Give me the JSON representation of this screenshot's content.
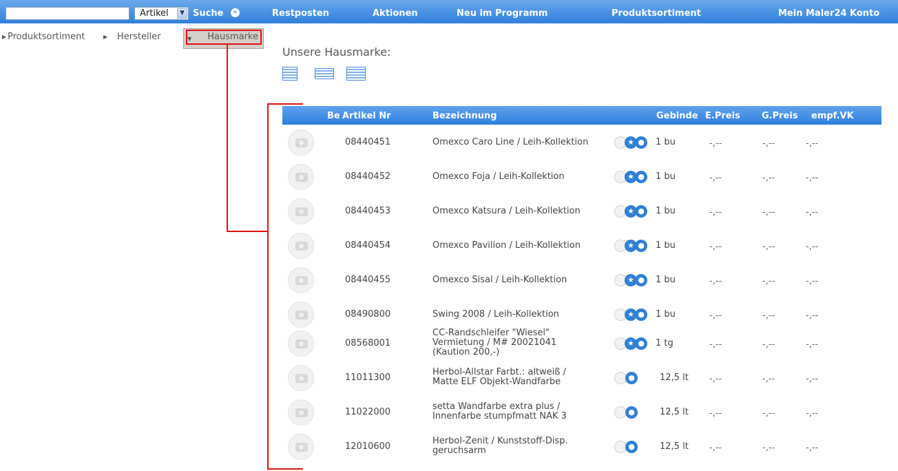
{
  "search": {
    "value": "",
    "scope": "Artikel",
    "submit_label": "Suche"
  },
  "nav": [
    "Restposten",
    "Aktionen",
    "Neu im Programm",
    "Produktsortiment",
    "Mein Maler24 Konto"
  ],
  "breadcrumb": [
    "Produktsortiment",
    "Hersteller",
    "Hausmarke"
  ],
  "page_title": "Unsere Hausmarke:",
  "table": {
    "headers": [
      "Be",
      "Artikel Nr",
      "Bezeichnung",
      "Gebinde",
      "E.Preis",
      "G.Preis",
      "empf.VK"
    ],
    "rows": [
      {
        "art": "08440451",
        "desc": [
          "Omexco Caro Line / Leih-Kollektion"
        ],
        "icons": [
          "gray",
          "star",
          "drop"
        ],
        "gebinde": "1 bu",
        "ep": "-,--",
        "gp": "-,--",
        "vk": "-,--"
      },
      {
        "art": "08440452",
        "desc": [
          "Omexco Foja / Leih-Kollektion"
        ],
        "icons": [
          "gray",
          "star",
          "drop"
        ],
        "gebinde": "1 bu",
        "ep": "-,--",
        "gp": "-,--",
        "vk": "-,--"
      },
      {
        "art": "08440453",
        "desc": [
          "Omexco Katsura / Leih-Kollektion"
        ],
        "icons": [
          "gray",
          "star",
          "drop"
        ],
        "gebinde": "1 bu",
        "ep": "-,--",
        "gp": "-,--",
        "vk": "-,--"
      },
      {
        "art": "08440454",
        "desc": [
          "Omexco Pavilion / Leih-Kollektion"
        ],
        "icons": [
          "gray",
          "star",
          "drop"
        ],
        "gebinde": "1 bu",
        "ep": "-,--",
        "gp": "-,--",
        "vk": "-,--"
      },
      {
        "art": "08440455",
        "desc": [
          "Omexco Sisal / Leih-Kollektion"
        ],
        "icons": [
          "gray",
          "star",
          "drop"
        ],
        "gebinde": "1 bu",
        "ep": "-,--",
        "gp": "-,--",
        "vk": "-,--"
      },
      {
        "art": "08490800",
        "desc": [
          "Swing 2008 / Leih-Kollektion"
        ],
        "icons": [
          "gray",
          "star",
          "drop"
        ],
        "gebinde": "1 bu",
        "ep": "-,--",
        "gp": "-,--",
        "vk": "-,--"
      },
      {
        "art": "08568001",
        "desc": [
          "CC-Randschleifer \"Wiesel\"",
          "Vermietung / M# 20021041",
          "(Kaution 200,-)"
        ],
        "icons": [
          "gray",
          "star",
          "drop"
        ],
        "gebinde": "1 tg",
        "ep": "-,--",
        "gp": "-,--",
        "vk": "-,--"
      },
      {
        "art": "11011300",
        "desc": [
          "Herbol-Allstar Farbt.: altweiß /",
          "Matte ELF Objekt-Wandfarbe"
        ],
        "icons": [
          "gray",
          "drop"
        ],
        "gebinde": "12,5 lt",
        "ep": "-,--",
        "gp": "-,--",
        "vk": "-,--"
      },
      {
        "art": "11022000",
        "desc": [
          "setta Wandfarbe extra plus /",
          "Innenfarbe stumpfmatt NAK 3"
        ],
        "icons": [
          "gray",
          "drop"
        ],
        "gebinde": "12,5 lt",
        "ep": "-,--",
        "gp": "-,--",
        "vk": "-,--"
      },
      {
        "art": "12010600",
        "desc": [
          "Herbol-Zenit / Kunststoff-Disp.",
          "geruchsarm"
        ],
        "icons": [
          "gray",
          "drop"
        ],
        "gebinde": "12,5 lt",
        "ep": "-,--",
        "gp": "-,--",
        "vk": "-,--"
      }
    ]
  },
  "colors": {
    "header_blue": "#2f80dc",
    "annotation_red": "#e01010"
  },
  "icon_names": {
    "gray": "info-icon",
    "star": "star-icon",
    "drop": "drop-icon"
  }
}
